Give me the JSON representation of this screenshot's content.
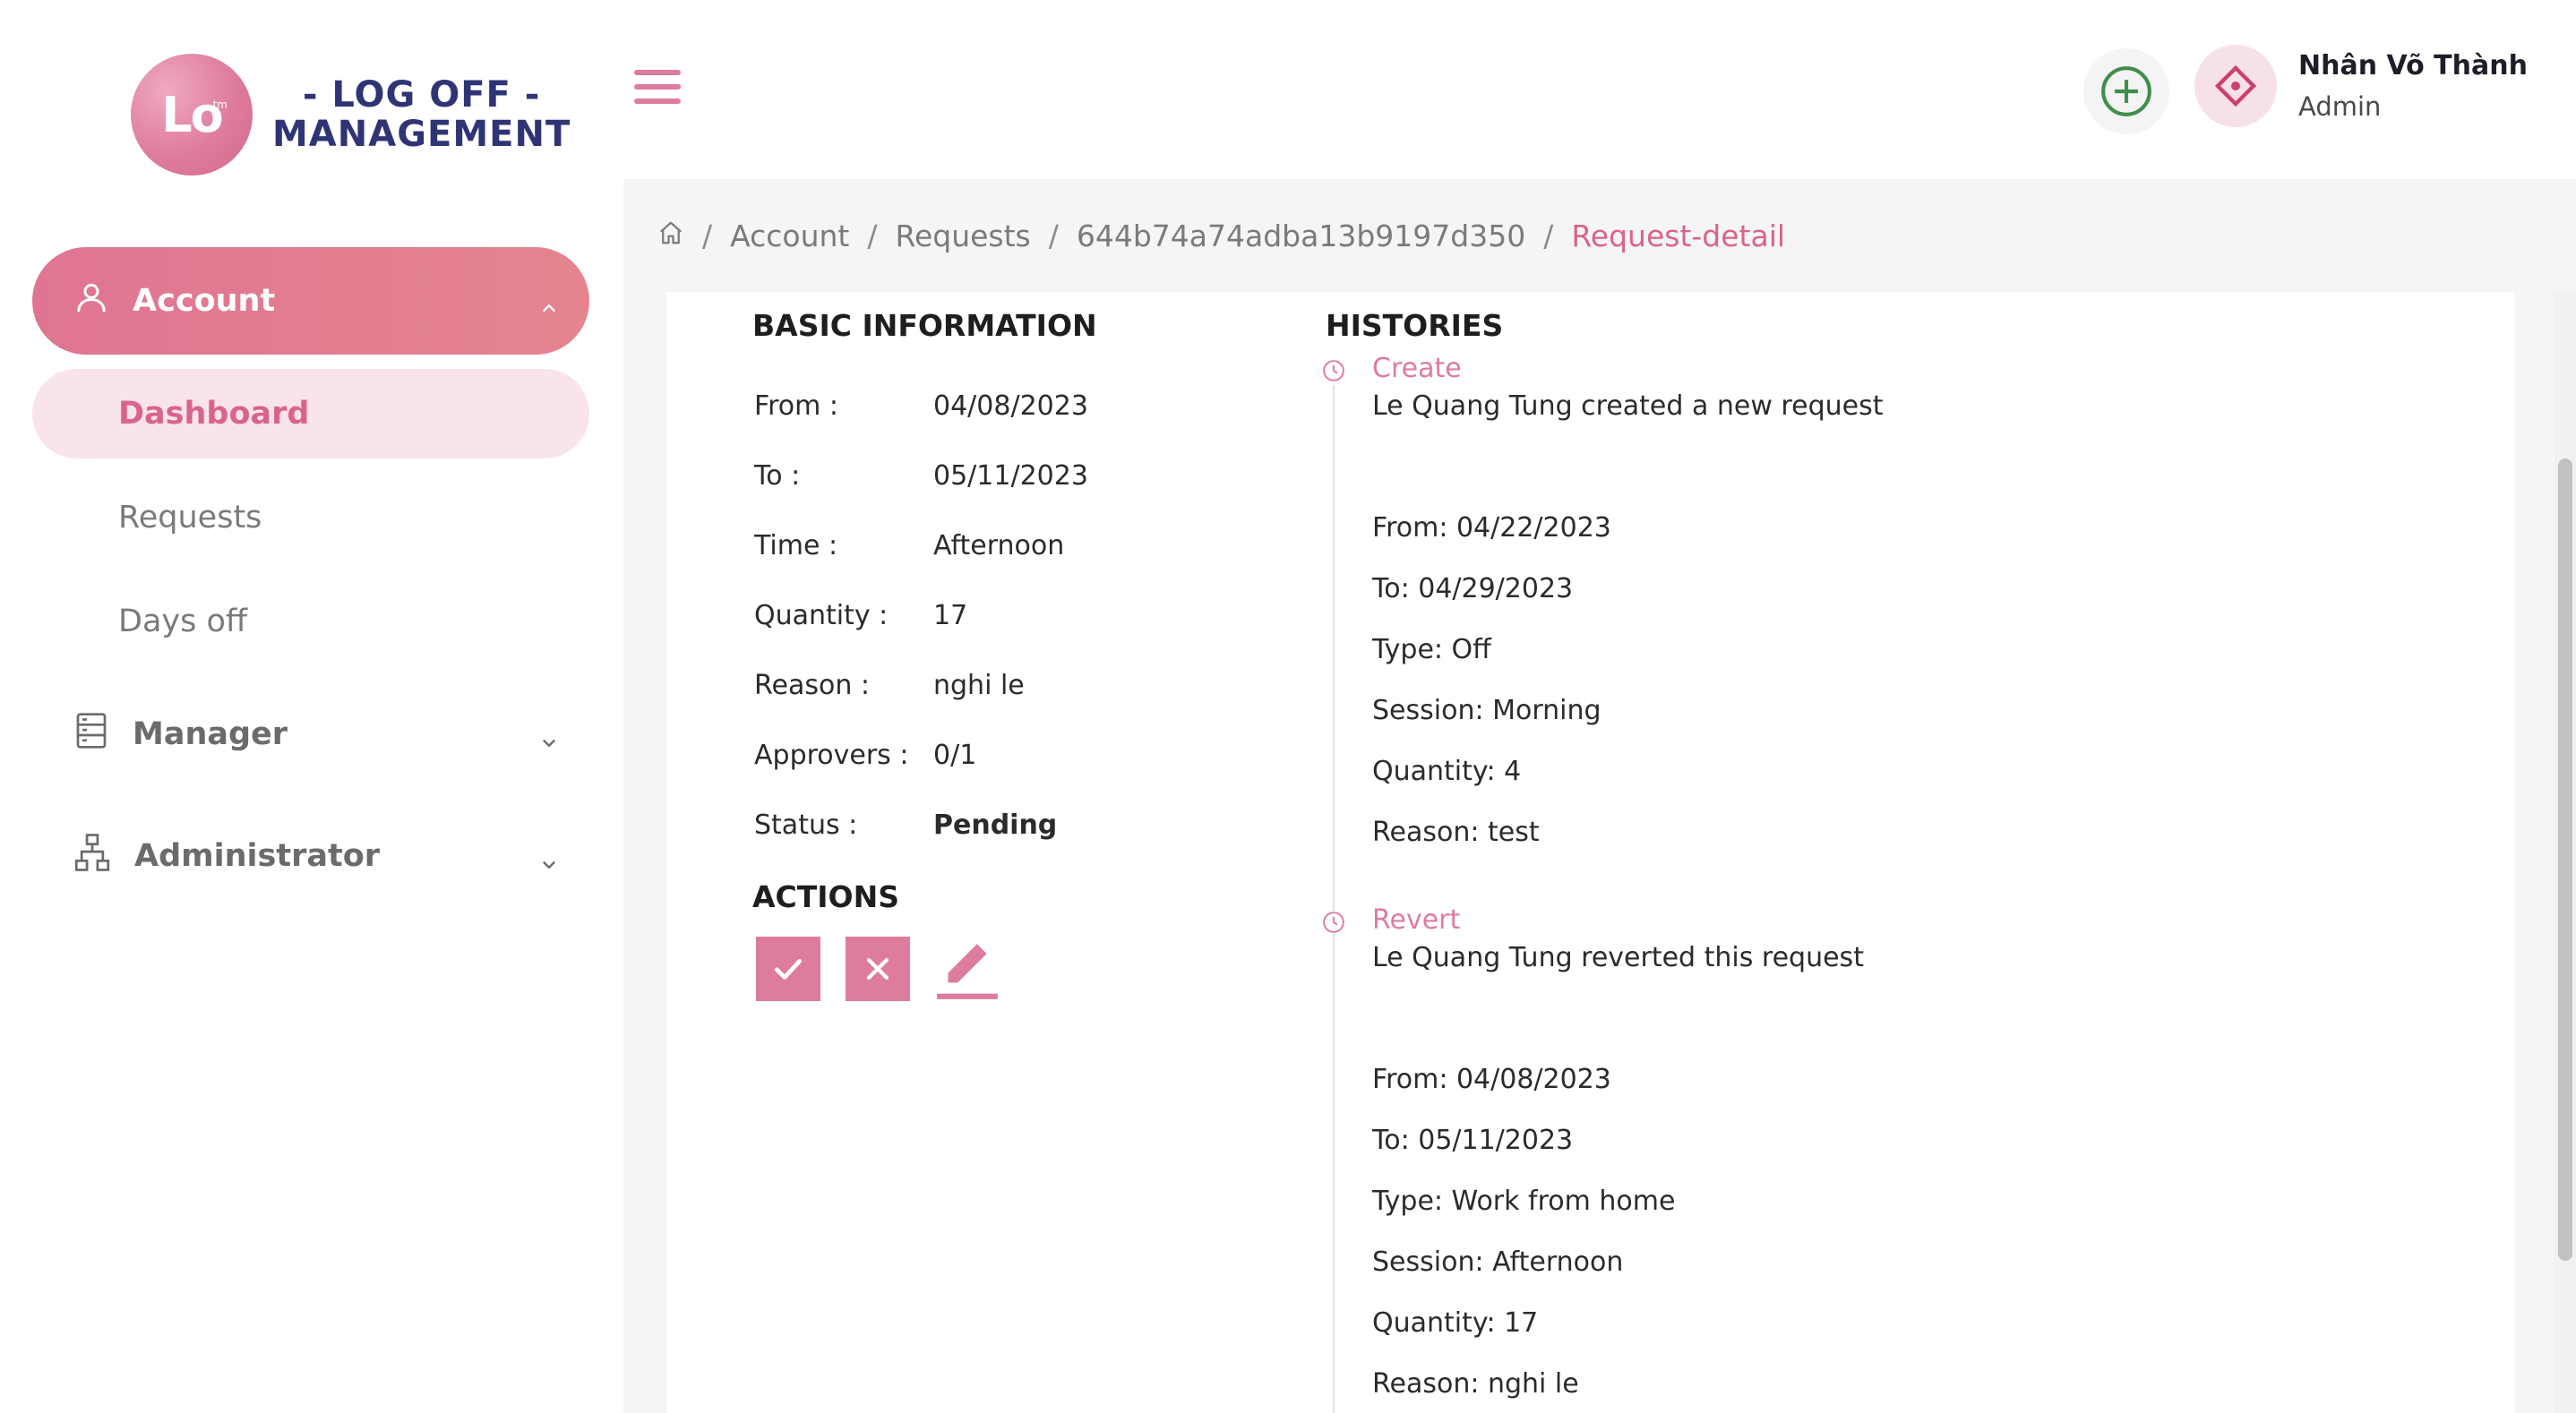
{
  "app": {
    "logo_mark": "Lo",
    "logo_tm": "tm",
    "logo_line1": "- LOG OFF -",
    "logo_line2": "MANAGEMENT"
  },
  "sidebar": {
    "account": {
      "label": "Account",
      "icon": "user-icon"
    },
    "account_items": [
      {
        "label": "Dashboard",
        "active": true
      },
      {
        "label": "Requests"
      },
      {
        "label": "Days off"
      }
    ],
    "manager": {
      "label": "Manager",
      "icon": "server-icon"
    },
    "administrator": {
      "label": "Administrator",
      "icon": "org-chart-icon"
    }
  },
  "header": {
    "user_name": "Nhân Võ Thành",
    "user_role": "Admin"
  },
  "breadcrumb": {
    "items": [
      "Account",
      "Requests",
      "644b74a74adba13b9197d350"
    ],
    "current": "Request-detail"
  },
  "basic_info": {
    "title": "BASIC INFORMATION",
    "rows": [
      {
        "label": "From :",
        "value": "04/08/2023"
      },
      {
        "label": "To :",
        "value": "05/11/2023"
      },
      {
        "label": "Time :",
        "value": "Afternoon"
      },
      {
        "label": "Quantity :",
        "value": "17"
      },
      {
        "label": "Reason :",
        "value": "nghi le"
      },
      {
        "label": "Approvers :",
        "value": "0/1"
      },
      {
        "label": "Status :",
        "value": "Pending"
      }
    ]
  },
  "actions": {
    "title": "ACTIONS",
    "buttons": [
      "approve",
      "reject",
      "edit"
    ]
  },
  "histories": {
    "title": "HISTORIES",
    "entries": [
      {
        "title": "Create",
        "description": "Le Quang Tung created a new request",
        "lines": [
          "From: 04/22/2023",
          "To: 04/29/2023",
          "Type: Off",
          "Session: Morning",
          "Quantity: 4",
          "Reason: test"
        ]
      },
      {
        "title": "Revert",
        "description": "Le Quang Tung reverted this request",
        "lines": [
          "From: 04/08/2023",
          "To: 05/11/2023",
          "Type: Work from home",
          "Session: Afternoon",
          "Quantity: 17",
          "Reason: nghi le"
        ]
      }
    ]
  },
  "colors": {
    "accent": "#de7c9b",
    "brand_text": "#2f3475",
    "add_icon": "#3f8f4a"
  }
}
